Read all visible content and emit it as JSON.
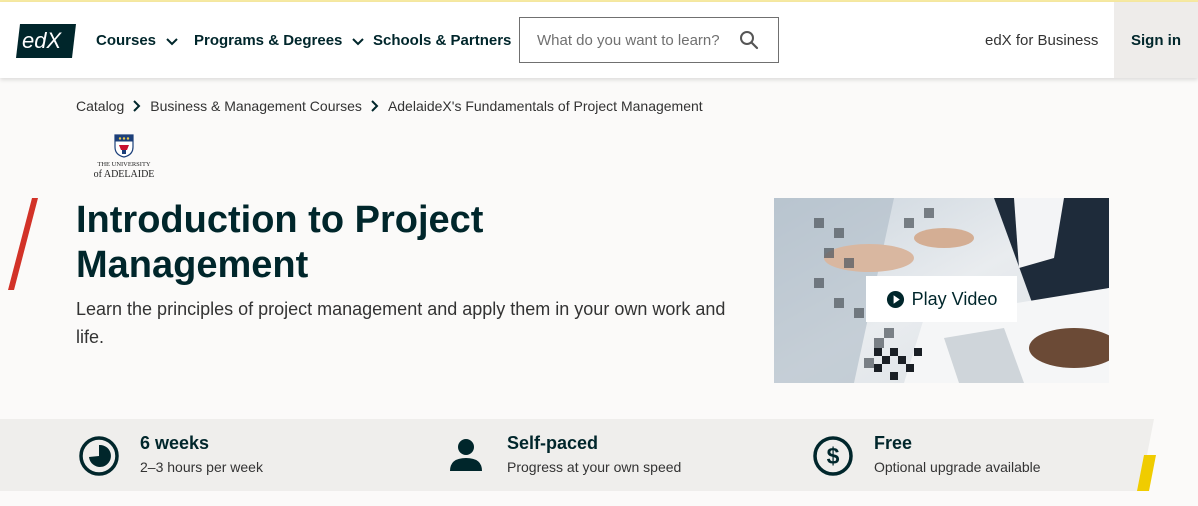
{
  "brand": {
    "logo_text": "edX",
    "accent_color": "#d23228",
    "highlight_color": "#f0cc00",
    "dark_color": "#00262b"
  },
  "header": {
    "nav": [
      {
        "label": "Courses",
        "has_dropdown": true
      },
      {
        "label": "Programs & Degrees",
        "has_dropdown": true
      },
      {
        "label": "Schools & Partners",
        "has_dropdown": false
      }
    ],
    "search_placeholder": "What do you want to learn?",
    "search_icon": "search-icon",
    "business_link": "edX for Business",
    "signin_label": "Sign in"
  },
  "breadcrumb": [
    "Catalog",
    "Business & Management Courses",
    "AdelaideX's Fundamentals of Project Management"
  ],
  "partner": {
    "line1": "THE UNIVERSITY",
    "line2": "of ADELAIDE"
  },
  "course": {
    "title": "Introduction to Project Management",
    "subtitle": "Learn the principles of project management and apply them in your own work and life."
  },
  "video": {
    "play_label": "Play Video",
    "icon": "play-circle-icon"
  },
  "facts": [
    {
      "icon": "clock-icon",
      "title": "6 weeks",
      "subtitle": "2–3 hours per week"
    },
    {
      "icon": "person-icon",
      "title": "Self-paced",
      "subtitle": "Progress at your own speed"
    },
    {
      "icon": "dollar-circle-icon",
      "title": "Free",
      "subtitle": "Optional upgrade available"
    }
  ]
}
